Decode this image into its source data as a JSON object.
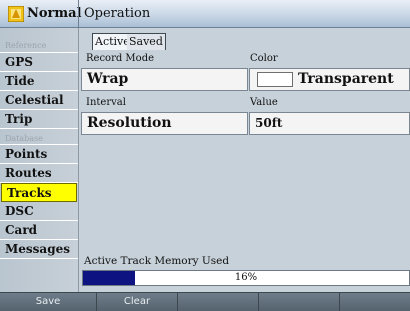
{
  "titlebar": {
    "mode_label": "Normal",
    "title": "Operation",
    "mode_icon": "yellow-mode-icon"
  },
  "sidebar": {
    "reference_heading": "Reference",
    "items_top": [
      "GPS",
      "Tide",
      "Celestial",
      "Trip"
    ],
    "database_heading": "Database",
    "items_bottom": [
      "Points",
      "Routes",
      "Tracks",
      "DSC",
      "Card",
      "Messages"
    ],
    "selected": "Tracks"
  },
  "tabs": [
    "Active",
    "Saved"
  ],
  "fields": {
    "record_mode_label": "Record Mode",
    "record_mode_value": "Wrap",
    "color_label": "Color",
    "color_value": "Transparent",
    "interval_label": "Interval",
    "interval_value": "Resolution",
    "value_label": "Value",
    "value_value": "50ft"
  },
  "memory": {
    "label": "Active Track Memory Used",
    "percent_text": "16%",
    "fraction": 0.16
  },
  "softkeys": [
    "Save",
    "Clear"
  ],
  "colors": {
    "selection_highlight": "#ffff00",
    "progress_fill": "#0d1380",
    "titlebar": "#c9d7e6",
    "background": "#c6d1d9"
  }
}
